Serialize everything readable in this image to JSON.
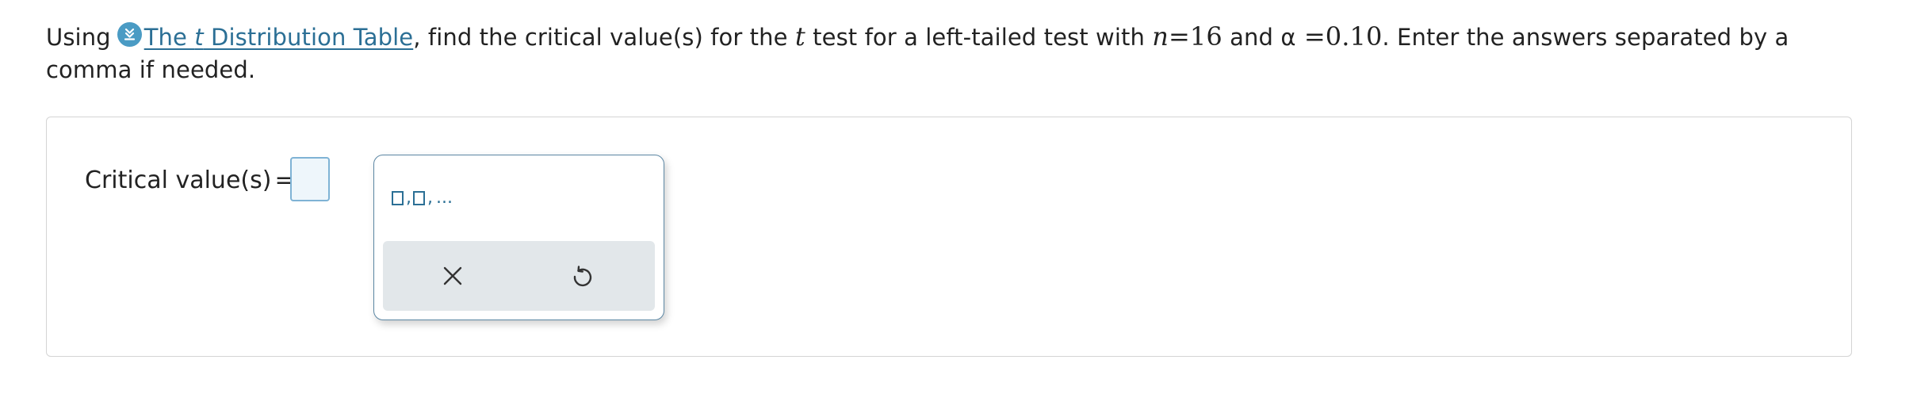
{
  "question": {
    "prefix": "Using",
    "link_pre": "The ",
    "link_var": "t",
    "link_post": " Distribution Table",
    "seg1": ", find the critical value(s) for the ",
    "var_t": "t",
    "seg2": " test for a left-tailed test with ",
    "var_n": "n",
    "eq_n": "=16",
    "seg3": " and ",
    "alpha": "α",
    "eq_alpha": " =0.10",
    "seg4": ". Enter the answers separated by a comma if needed."
  },
  "answer": {
    "label": "Critical value(s)",
    "equals": "=",
    "value": ""
  },
  "palette": {
    "template_sep": ",",
    "template_dots": "...",
    "clear_icon": "close-icon",
    "reset_icon": "undo-icon"
  },
  "colors": {
    "link": "#2b6f95",
    "icon_bg": "#4a9bc4",
    "input_border": "#7fb3d5",
    "input_bg": "#eef6fb",
    "toolbar_bg": "#e2e7ea"
  }
}
